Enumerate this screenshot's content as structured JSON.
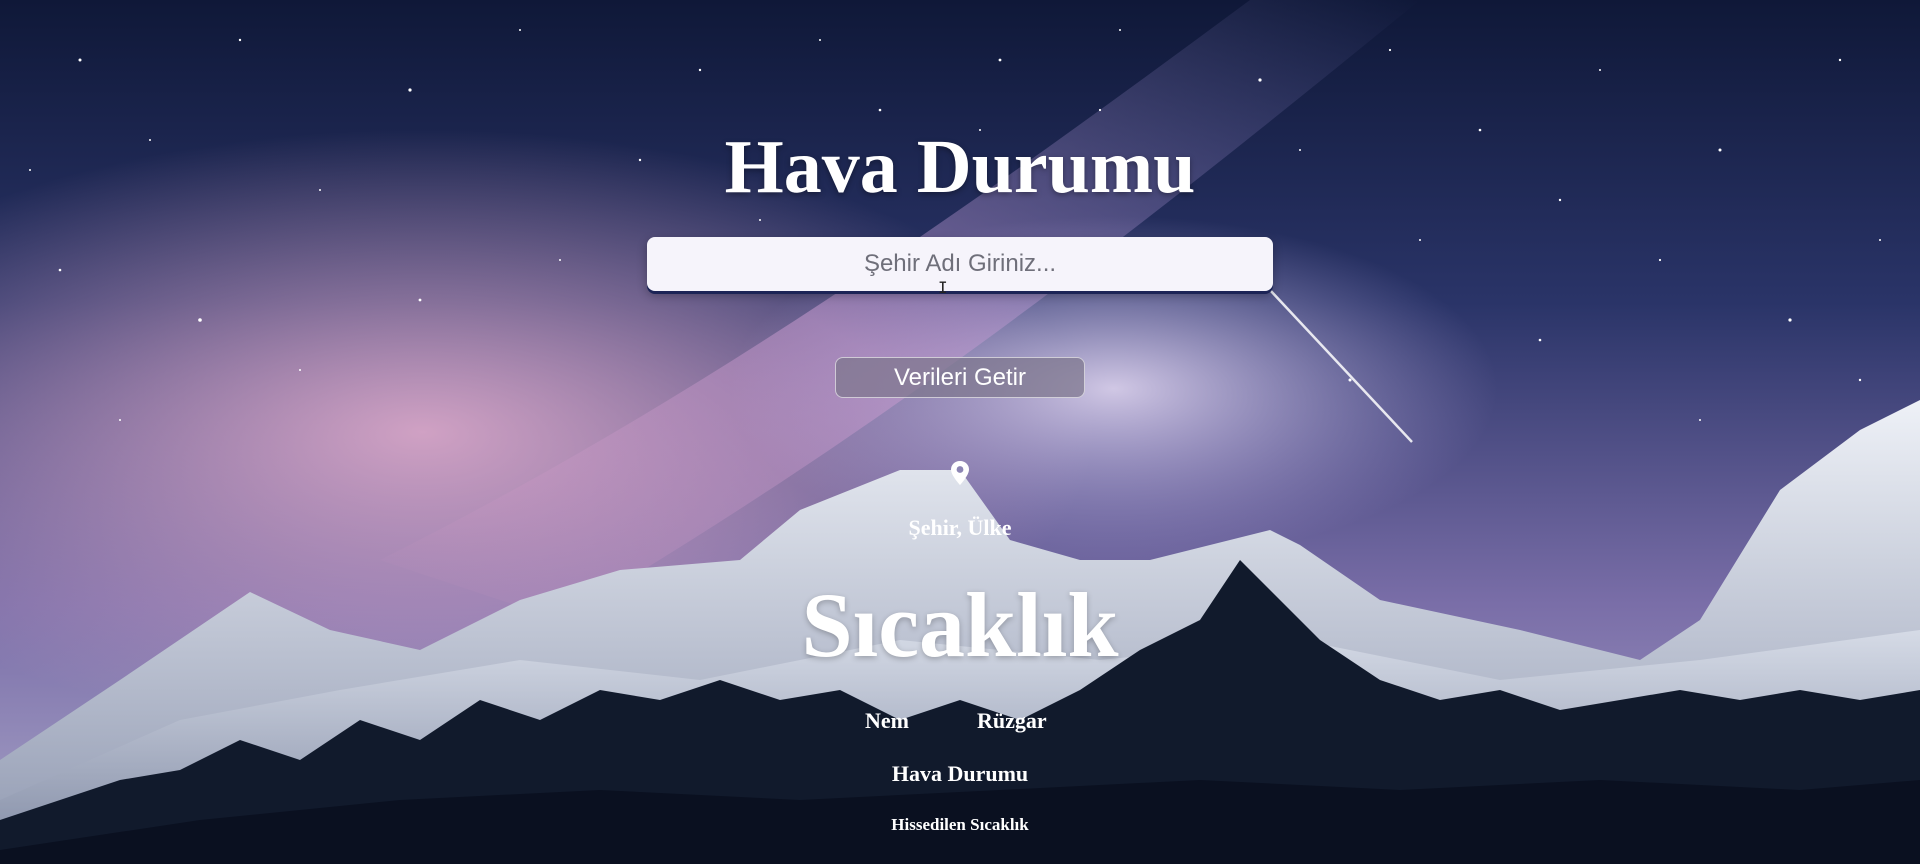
{
  "colors": {
    "text": "#ffffff",
    "input_background": "#f6f4fb",
    "button_background": "#7d768c",
    "sky_top": "#14204a",
    "sky_glow": "#c98fc0",
    "snow": "#e4e9f1",
    "forest": "#0c1424"
  },
  "header": {
    "title": "Hava Durumu"
  },
  "search": {
    "placeholder": "Şehir Adı Giriniz...",
    "value": ""
  },
  "actions": {
    "fetch_label": "Verileri Getir"
  },
  "weather": {
    "location_icon": "map-pin-icon",
    "location": "Şehir, Ülke",
    "temperature": "Sıcaklık",
    "humidity": "Nem",
    "wind": "Rüzgar",
    "condition": "Hava Durumu",
    "feels_like": "Hissedilen Sıcaklık"
  }
}
